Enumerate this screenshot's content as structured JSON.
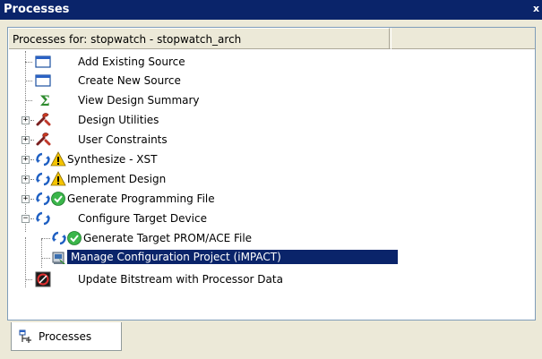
{
  "window": {
    "title": "Processes",
    "close_glyph": "x"
  },
  "header": {
    "label": "Processes for: stopwatch - stopwatch_arch"
  },
  "processes": [
    {
      "label": "Add Existing Source",
      "icon": "source-window-icon"
    },
    {
      "label": "Create New Source",
      "icon": "source-window-icon"
    },
    {
      "label": "View Design Summary",
      "icon": "sigma-icon"
    },
    {
      "label": "Design Utilities",
      "icon": "tools-icon",
      "expandable": true
    },
    {
      "label": "User Constraints",
      "icon": "tools-icon",
      "expandable": true
    },
    {
      "label": "Synthesize - XST",
      "icon": "run-icon",
      "status": "warning-icon",
      "expandable": true
    },
    {
      "label": "Implement Design",
      "icon": "run-icon",
      "status": "warning-icon",
      "expandable": true
    },
    {
      "label": "Generate Programming File",
      "icon": "run-icon",
      "status": "check-icon",
      "expandable": true
    },
    {
      "label": "Configure Target Device",
      "icon": "run-icon",
      "expanded": true
    },
    {
      "label": "Generate Target PROM/ACE File",
      "icon": "run-icon",
      "status": "check-icon",
      "child": true
    },
    {
      "label": "Manage Configuration Project (iMPACT)",
      "icon": "impact-icon",
      "child": true,
      "selected": true
    },
    {
      "label": "Update Bitstream with Processor Data",
      "icon": "chip-icon"
    }
  ],
  "tabs": [
    {
      "label": "Processes",
      "icon": "processes-tab-icon"
    }
  ],
  "colors": {
    "titlebar": "#0a246a",
    "selection": "#0a246a",
    "warning": "#f5c400",
    "ok": "#3ab54a",
    "run": "#1e5fc2"
  }
}
